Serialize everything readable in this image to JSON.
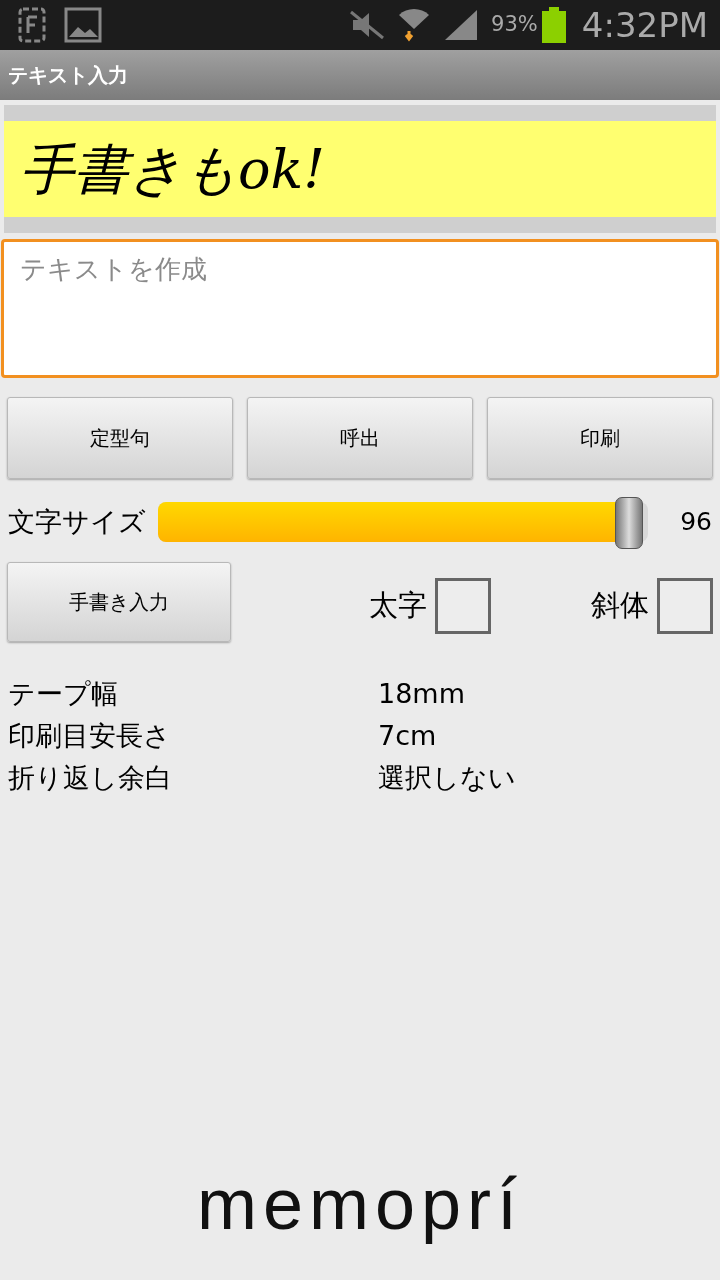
{
  "status_bar": {
    "battery": "93%",
    "time": "4:32PM"
  },
  "title_bar": {
    "title": "テキスト入力"
  },
  "preview": {
    "text": "手書きもok!"
  },
  "text_field": {
    "placeholder": "テキストを作成"
  },
  "buttons": [
    "定型句",
    "呼出",
    "印刷"
  ],
  "font_size": {
    "label": "文字サイズ",
    "level": 0.97,
    "reading": "96"
  },
  "handwriting_button": "手書き入力",
  "checkboxes": [
    {
      "label": "太字",
      "checked": false
    },
    {
      "label": "斜体",
      "checked": false
    }
  ],
  "info": [
    {
      "label": "テープ幅",
      "value": "18mm"
    },
    {
      "label": "印刷目安長さ",
      "value": "7cm"
    },
    {
      "label": "折り返し余白",
      "value": "選択しない"
    }
  ],
  "logo": "memoprí"
}
